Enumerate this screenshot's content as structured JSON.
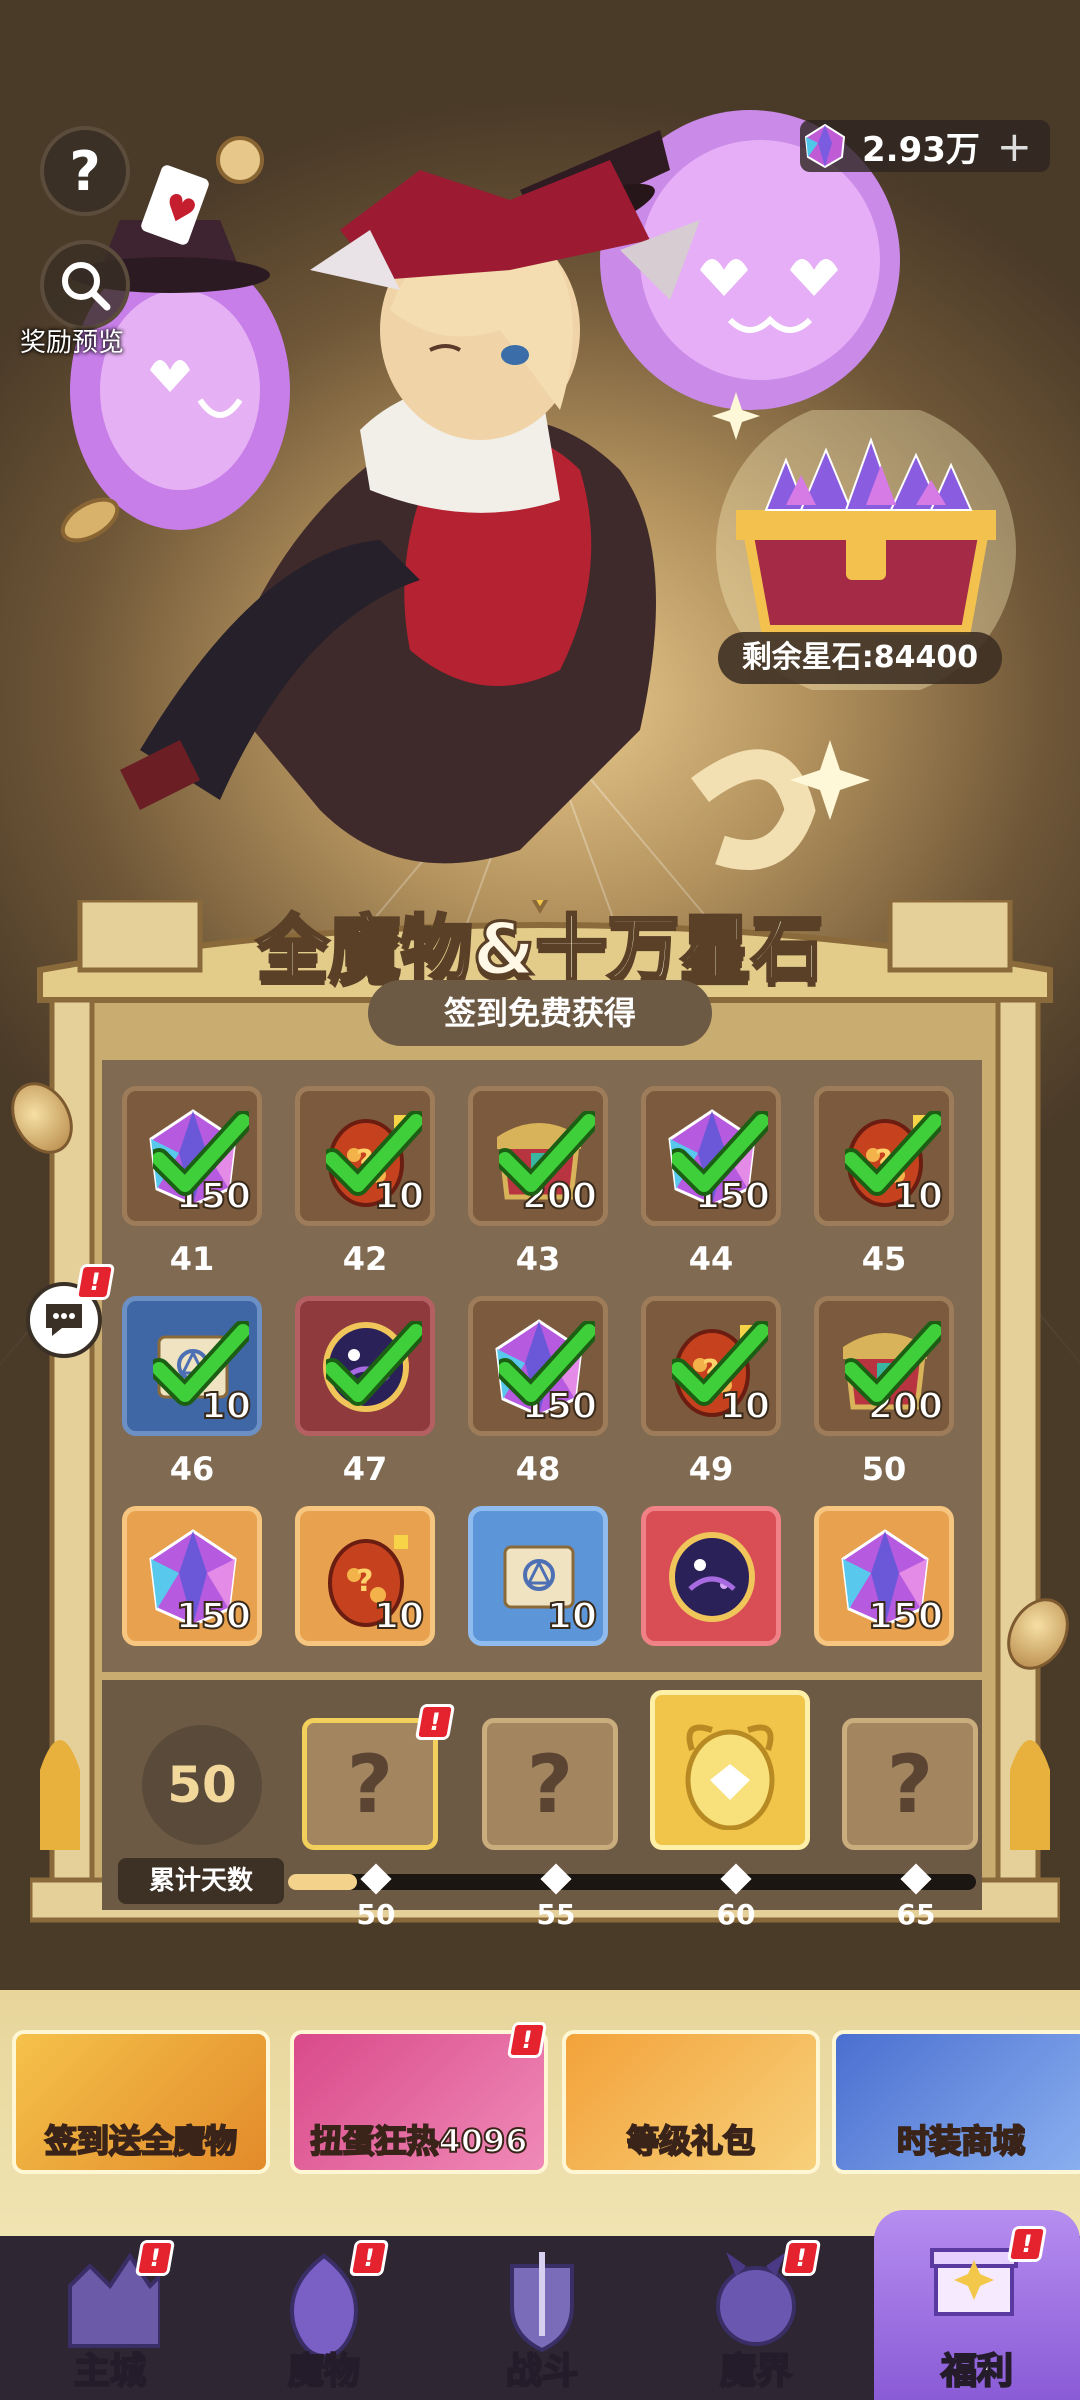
{
  "top": {
    "help_icon": "question-icon",
    "preview_label": "奖励预览",
    "currency_value": "2.93万",
    "currency_plus": "+"
  },
  "chest": {
    "remaining_label": "剩余星石:84400"
  },
  "event": {
    "title": "全魔物&十万星石",
    "subtitle": "签到免费获得"
  },
  "rewards": [
    {
      "day": "41",
      "qty": "150",
      "item": "star-gem",
      "claimed": true
    },
    {
      "day": "42",
      "qty": "10",
      "item": "gacha-egg",
      "claimed": true
    },
    {
      "day": "43",
      "qty": "200",
      "item": "chest",
      "claimed": true
    },
    {
      "day": "44",
      "qty": "150",
      "item": "star-gem",
      "claimed": true
    },
    {
      "day": "45",
      "qty": "10",
      "item": "gacha-egg",
      "claimed": true
    },
    {
      "day": "46",
      "qty": "10",
      "item": "scroll",
      "claimed": true
    },
    {
      "day": "47",
      "qty": "",
      "item": "cosmic-orb",
      "claimed": true
    },
    {
      "day": "48",
      "qty": "150",
      "item": "star-gem",
      "claimed": true
    },
    {
      "day": "49",
      "qty": "10",
      "item": "gacha-egg",
      "claimed": true
    },
    {
      "day": "50",
      "qty": "200",
      "item": "chest",
      "claimed": true
    },
    {
      "day": "",
      "qty": "150",
      "item": "star-gem",
      "claimed": false
    },
    {
      "day": "",
      "qty": "10",
      "item": "gacha-egg",
      "claimed": false
    },
    {
      "day": "",
      "qty": "10",
      "item": "scroll",
      "claimed": false
    },
    {
      "day": "",
      "qty": "",
      "item": "cosmic-orb",
      "claimed": false
    },
    {
      "day": "",
      "qty": "150",
      "item": "star-gem",
      "claimed": false
    }
  ],
  "cumulative": {
    "days": "50",
    "label": "累计天数",
    "milestones": [
      "50",
      "55",
      "60",
      "65"
    ],
    "mystery": "?",
    "progress": 0.1
  },
  "events": [
    {
      "label": "签到送全魔物",
      "badge": false
    },
    {
      "label": "扭蛋狂热4096",
      "badge": true
    },
    {
      "label": "等级礼包",
      "badge": false
    },
    {
      "label": "时装商城",
      "badge": false
    }
  ],
  "nav": [
    {
      "label": "主城",
      "icon": "castle-icon",
      "badge": true
    },
    {
      "label": "魔物",
      "icon": "flame-monster-icon",
      "badge": true
    },
    {
      "label": "战斗",
      "icon": "sword-shield-icon",
      "badge": false
    },
    {
      "label": "魔界",
      "icon": "demon-realm-icon",
      "badge": true
    },
    {
      "label": "福利",
      "icon": "gift-chest-icon",
      "badge": true
    }
  ],
  "badge_text": "!",
  "colors": {
    "accent_gold": "#f3d28c",
    "check_green": "#3fcf3a",
    "badge_red": "#e5232f",
    "nav_active": "#a77ae6"
  }
}
